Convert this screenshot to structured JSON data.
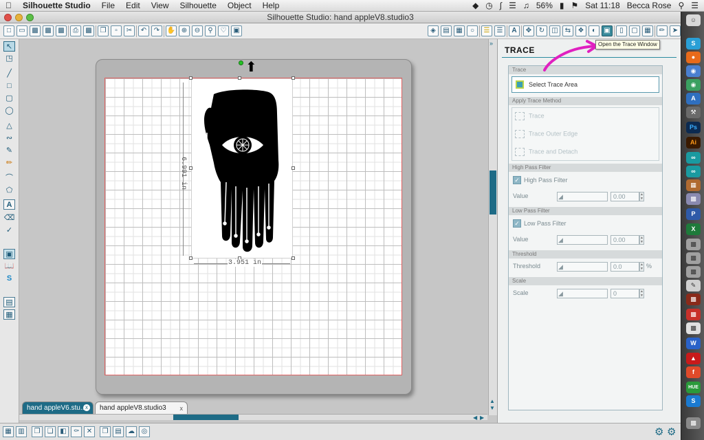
{
  "menubar": {
    "apple_icon": "apple-icon",
    "app_name": "Silhouette Studio",
    "items": [
      "File",
      "Edit",
      "View",
      "Silhouette",
      "Object",
      "Help"
    ],
    "battery": "56%",
    "clock": "Sat 11:18",
    "user": "Becca Rose"
  },
  "window": {
    "title": "Silhouette Studio: hand appleV8.studio3"
  },
  "canvas": {
    "width_dim": "3.951 in",
    "height_dim": "6.991 in"
  },
  "tabs": [
    {
      "label": "hand appleV6.stu..."
    },
    {
      "label": "hand appleV8.studio3"
    }
  ],
  "tooltip": "Open the Trace Window",
  "panel": {
    "title": "TRACE",
    "section_trace": "Trace",
    "select_trace_area": "Select Trace Area",
    "section_apply": "Apply Trace Method",
    "methods": [
      "Trace",
      "Trace Outer Edge",
      "Trace and Detach"
    ],
    "section_high": "High Pass Filter",
    "high_pass_label": "High Pass Filter",
    "high_value_label": "Value",
    "high_value": "0.00",
    "section_low": "Low Pass Filter",
    "low_pass_label": "Low Pass Filter",
    "low_value_label": "Value",
    "low_value": "0.00",
    "section_threshold": "Threshold",
    "threshold_label": "Threshold",
    "threshold_value": "0.0",
    "threshold_unit": "%",
    "section_scale": "Scale",
    "scale_label": "Scale",
    "scale_value": "0"
  },
  "colors": {
    "accent": "#2a8aa0",
    "annotation": "#e020c0"
  }
}
